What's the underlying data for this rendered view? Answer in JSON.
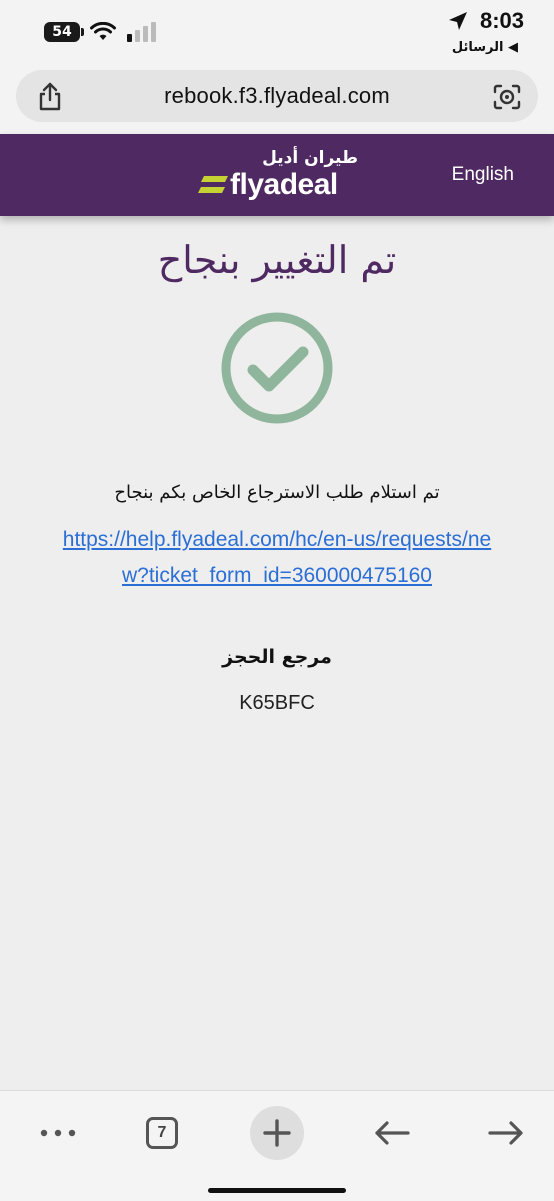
{
  "status_bar": {
    "time": "8:03",
    "battery": "54",
    "back_app": "الرسائل"
  },
  "browser": {
    "url": "rebook.f3.flyadeal.com",
    "tab_count": "7"
  },
  "header": {
    "logo_ar": "طيران أديل",
    "logo_en": "flyadeal",
    "lang_link": "English"
  },
  "content": {
    "title": "تم التغيير بنجاح",
    "message": "تم استلام طلب الاسترجاع الخاص بكم بنجاح",
    "help_link": "https://help.flyadeal.com/hc/en-us/requests/new?ticket_form_id=360000475160",
    "ref_label": "مرجع الحجز",
    "ref_value": "K65BFC"
  },
  "colors": {
    "brand": "#4f2a62",
    "accent": "#c6d233",
    "success": "#8fb69c",
    "link": "#2b6fd6"
  }
}
